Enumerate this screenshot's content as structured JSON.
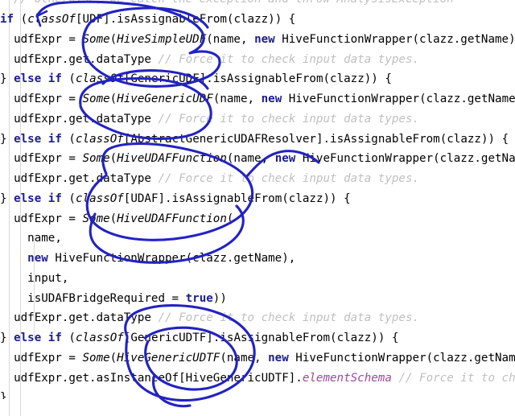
{
  "editor": {
    "name": "code-editor-pane",
    "language": "Scala",
    "background_color": "#ffffff",
    "indent_guide_color": "#d9d9d9",
    "indent_guide_positions": [
      11,
      25,
      42
    ],
    "syntax_colors": {
      "keyword": "#1d1d8c",
      "type_italic": "#000000",
      "comment": "#c0c0c0",
      "field": "#9a4a9a",
      "plain": "#000000"
    }
  },
  "annotation": {
    "name": "freehand-ink-annotation",
    "color": "#2222c4",
    "tool": "pen",
    "stroke_count": 6
  },
  "code": {
    "lines": [
      {
        "clipped": "top",
        "tokens": [
          {
            "style": "cmt",
            "text": "  // otherwise, we catch the exception and throw AnalysisException"
          }
        ]
      },
      {
        "tokens": [
          {
            "style": "kw",
            "text": "if"
          },
          {
            "style": "plain",
            "text": " ("
          },
          {
            "style": "typ",
            "text": "classOf"
          },
          {
            "style": "plain",
            "text": "[UDF].isAssignableFrom(clazz)) {"
          }
        ]
      },
      {
        "tokens": [
          {
            "style": "plain",
            "text": "  udfExpr = "
          },
          {
            "style": "typ",
            "text": "Some"
          },
          {
            "style": "plain",
            "text": "("
          },
          {
            "style": "typ",
            "text": "HiveSimpleUDF"
          },
          {
            "style": "plain",
            "text": "(name, "
          },
          {
            "style": "kw",
            "text": "new"
          },
          {
            "style": "plain",
            "text": " HiveFunctionWrapper(clazz.getName),"
          }
        ]
      },
      {
        "tokens": [
          {
            "style": "plain",
            "text": "  udfExpr.get.dataType "
          },
          {
            "style": "cmt",
            "text": "// Force it to check input data types."
          }
        ]
      },
      {
        "tokens": [
          {
            "style": "plain",
            "text": "} "
          },
          {
            "style": "kw",
            "text": "else if"
          },
          {
            "style": "plain",
            "text": " ("
          },
          {
            "style": "typ",
            "text": "classOf"
          },
          {
            "style": "plain",
            "text": "[GenericUDF].isAssignableFrom(clazz)) {"
          }
        ]
      },
      {
        "tokens": [
          {
            "style": "plain",
            "text": "  udfExpr = "
          },
          {
            "style": "typ",
            "text": "Some"
          },
          {
            "style": "plain",
            "text": "("
          },
          {
            "style": "typ",
            "text": "HiveGenericUDF"
          },
          {
            "style": "plain",
            "text": "(name, "
          },
          {
            "style": "kw",
            "text": "new"
          },
          {
            "style": "plain",
            "text": " HiveFunctionWrapper(clazz.getName),"
          }
        ]
      },
      {
        "tokens": [
          {
            "style": "plain",
            "text": "  udfExpr.get.dataType "
          },
          {
            "style": "cmt",
            "text": "// Force it to check input data types."
          }
        ]
      },
      {
        "tokens": [
          {
            "style": "plain",
            "text": "} "
          },
          {
            "style": "kw",
            "text": "else if"
          },
          {
            "style": "plain",
            "text": " ("
          },
          {
            "style": "typ",
            "text": "classOf"
          },
          {
            "style": "plain",
            "text": "[AbstractGenericUDAFResolver].isAssignableFrom(clazz)) {"
          }
        ]
      },
      {
        "tokens": [
          {
            "style": "plain",
            "text": "  udfExpr = "
          },
          {
            "style": "typ",
            "text": "Some"
          },
          {
            "style": "plain",
            "text": "("
          },
          {
            "style": "typ",
            "text": "HiveUDAFFunction"
          },
          {
            "style": "plain",
            "text": "(name, "
          },
          {
            "style": "kw",
            "text": "new"
          },
          {
            "style": "plain",
            "text": " HiveFunctionWrapper(clazz.getName"
          }
        ]
      },
      {
        "tokens": [
          {
            "style": "plain",
            "text": "  udfExpr.get.dataType "
          },
          {
            "style": "cmt",
            "text": "// Force it to check input data types."
          }
        ]
      },
      {
        "tokens": [
          {
            "style": "plain",
            "text": "} "
          },
          {
            "style": "kw",
            "text": "else if"
          },
          {
            "style": "plain",
            "text": " ("
          },
          {
            "style": "typ",
            "text": "classOf"
          },
          {
            "style": "plain",
            "text": "[UDAF].isAssignableFrom(clazz)) {"
          }
        ]
      },
      {
        "tokens": [
          {
            "style": "plain",
            "text": "  udfExpr = "
          },
          {
            "style": "typ",
            "text": "Some"
          },
          {
            "style": "plain",
            "text": "("
          },
          {
            "style": "typ",
            "text": "HiveUDAFFunction"
          },
          {
            "style": "plain",
            "text": "("
          }
        ]
      },
      {
        "tokens": [
          {
            "style": "plain",
            "text": "    name,"
          }
        ]
      },
      {
        "tokens": [
          {
            "style": "plain",
            "text": "    "
          },
          {
            "style": "kw",
            "text": "new"
          },
          {
            "style": "plain",
            "text": " HiveFunctionWrapper(clazz.getName),"
          }
        ]
      },
      {
        "tokens": [
          {
            "style": "plain",
            "text": "    input,"
          }
        ]
      },
      {
        "tokens": [
          {
            "style": "plain",
            "text": "    isUDAFBridgeRequired = "
          },
          {
            "style": "kw",
            "text": "true"
          },
          {
            "style": "plain",
            "text": "))"
          }
        ]
      },
      {
        "tokens": [
          {
            "style": "plain",
            "text": "  udfExpr.get.dataType "
          },
          {
            "style": "cmt",
            "text": "// Force it to check input data types."
          }
        ]
      },
      {
        "tokens": [
          {
            "style": "plain",
            "text": "} "
          },
          {
            "style": "kw",
            "text": "else if"
          },
          {
            "style": "plain",
            "text": " ("
          },
          {
            "style": "typ",
            "text": "classOf"
          },
          {
            "style": "plain",
            "text": "[GenericUDTF].isAssignableFrom(clazz)) {"
          }
        ]
      },
      {
        "tokens": [
          {
            "style": "plain",
            "text": "  udfExpr = "
          },
          {
            "style": "typ",
            "text": "Some"
          },
          {
            "style": "plain",
            "text": "("
          },
          {
            "style": "typ",
            "text": "HiveGenericUDTF"
          },
          {
            "style": "plain",
            "text": "(name, "
          },
          {
            "style": "kw",
            "text": "new"
          },
          {
            "style": "plain",
            "text": " HiveFunctionWrapper(clazz.getName)"
          }
        ]
      },
      {
        "tokens": [
          {
            "style": "plain",
            "text": "  udfExpr.get.asInstanceOf[HiveGenericUDTF]."
          },
          {
            "style": "fld",
            "text": "elementSchema"
          },
          {
            "style": "plain",
            "text": " "
          },
          {
            "style": "cmt",
            "text": "// Force it to chec"
          }
        ]
      },
      {
        "clipped": "bottom",
        "tokens": [
          {
            "style": "plain",
            "text": "}"
          }
        ]
      }
    ]
  }
}
